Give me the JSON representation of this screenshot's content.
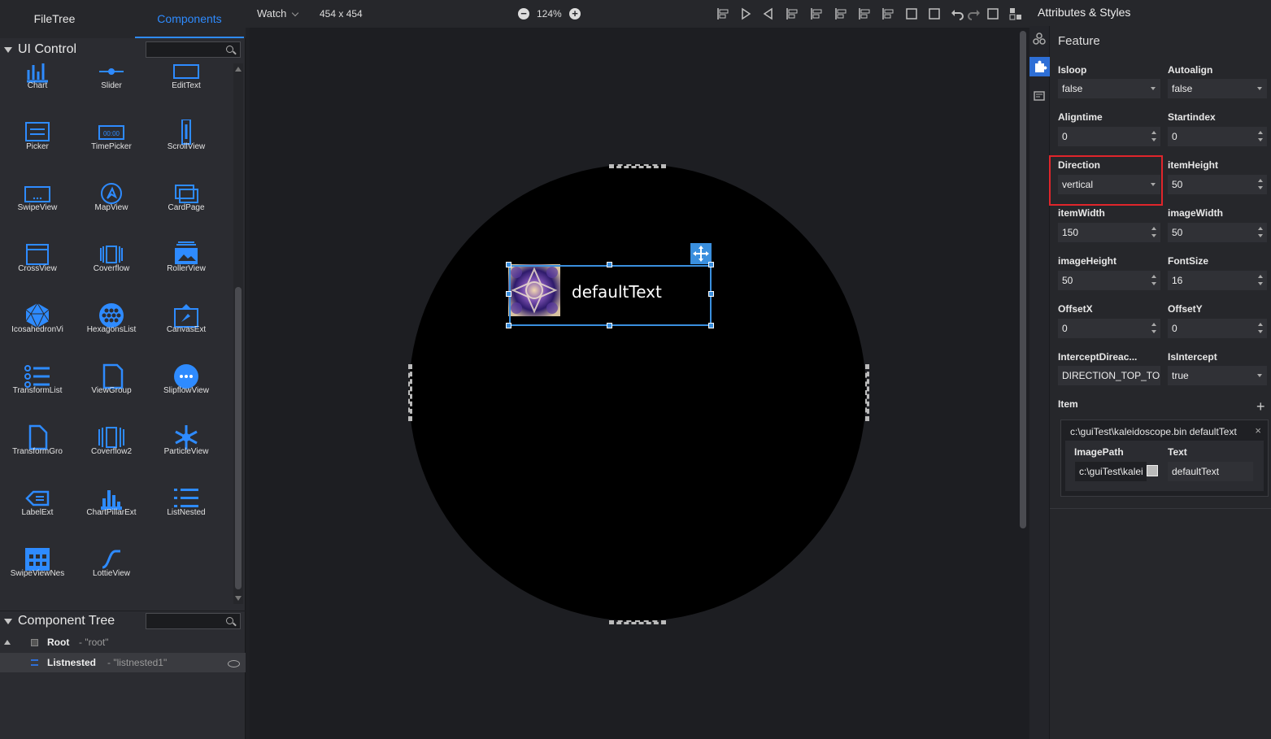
{
  "left_tabs": {
    "filetree": "FileTree",
    "components": "Components"
  },
  "ui_control": {
    "title": "UI Control",
    "search_placeholder": ""
  },
  "controls": [
    {
      "label": "Chart",
      "icon": "chart-icon"
    },
    {
      "label": "Slider",
      "icon": "slider-icon"
    },
    {
      "label": "EditText",
      "icon": "edittext-icon"
    },
    {
      "label": "Picker",
      "icon": "picker-icon"
    },
    {
      "label": "TimePicker",
      "icon": "timepicker-icon"
    },
    {
      "label": "ScrollView",
      "icon": "scrollview-icon"
    },
    {
      "label": "SwipeView",
      "icon": "swipeview-icon"
    },
    {
      "label": "MapView",
      "icon": "mapview-icon"
    },
    {
      "label": "CardPage",
      "icon": "cardpage-icon"
    },
    {
      "label": "CrossView",
      "icon": "crossview-icon"
    },
    {
      "label": "Coverflow",
      "icon": "coverflow-icon"
    },
    {
      "label": "RollerView",
      "icon": "rollerview-icon"
    },
    {
      "label": "IcosahedronVi",
      "icon": "icosahedron-icon"
    },
    {
      "label": "HexagonsList",
      "icon": "hexagonslist-icon"
    },
    {
      "label": "CanvasExt",
      "icon": "canvasext-icon"
    },
    {
      "label": "TransformList",
      "icon": "transformlist-icon"
    },
    {
      "label": "ViewGroup",
      "icon": "viewgroup-icon"
    },
    {
      "label": "SlipflowView",
      "icon": "slipflowview-icon"
    },
    {
      "label": "TransformGro",
      "icon": "transformgroup-icon"
    },
    {
      "label": "Coverflow2",
      "icon": "coverflow2-icon"
    },
    {
      "label": "ParticleView",
      "icon": "particleview-icon"
    },
    {
      "label": "LabelExt",
      "icon": "labelext-icon"
    },
    {
      "label": "ChartPillarExt",
      "icon": "chartpillar-icon"
    },
    {
      "label": "ListNested",
      "icon": "listnested-icon"
    },
    {
      "label": "SwipeViewNes",
      "icon": "swipeviewnested-icon"
    },
    {
      "label": "LottieView",
      "icon": "lottieview-icon"
    }
  ],
  "component_tree": {
    "title": "Component Tree",
    "root": {
      "name": "Root",
      "id": "- \"root\""
    },
    "child": {
      "name": "Listnested",
      "id": "- \"listnested1\""
    }
  },
  "toolbar": {
    "watch": "Watch",
    "resolution": "454 x 454",
    "zoom": "124%"
  },
  "canvas": {
    "widget_text": "defaultText"
  },
  "right_panel": {
    "title": "Attributes & Styles",
    "section": "Feature",
    "props": {
      "isloop": {
        "label": "Isloop",
        "value": "false"
      },
      "autoalign": {
        "label": "Autoalign",
        "value": "false"
      },
      "aligntime": {
        "label": "Aligntime",
        "value": "0"
      },
      "startindex": {
        "label": "Startindex",
        "value": "0"
      },
      "direction": {
        "label": "Direction",
        "value": "vertical"
      },
      "itemheight": {
        "label": "itemHeight",
        "value": "50"
      },
      "itemwidth": {
        "label": "itemWidth",
        "value": "150"
      },
      "imagewidth": {
        "label": "imageWidth",
        "value": "50"
      },
      "imageheight": {
        "label": "imageHeight",
        "value": "50"
      },
      "fontsize": {
        "label": "FontSize",
        "value": "16"
      },
      "offsetx": {
        "label": "OffsetX",
        "value": "0"
      },
      "offsety": {
        "label": "OffsetY",
        "value": "0"
      },
      "intercept": {
        "label": "InterceptDireac...",
        "value": "DIRECTION_TOP_TO"
      },
      "isintercept": {
        "label": "IsIntercept",
        "value": "true"
      }
    },
    "item": {
      "label": "Item",
      "header": "c:\\guiTest\\kaleidoscope.bin defaultText",
      "imagepath_label": "ImagePath",
      "imagepath_value": "c:\\guiTest\\kalei",
      "text_label": "Text",
      "text_value": "defaultText"
    }
  },
  "colors": {
    "accent": "#2e8bff",
    "highlight": "#e0252b",
    "selection": "#3a8fde"
  }
}
